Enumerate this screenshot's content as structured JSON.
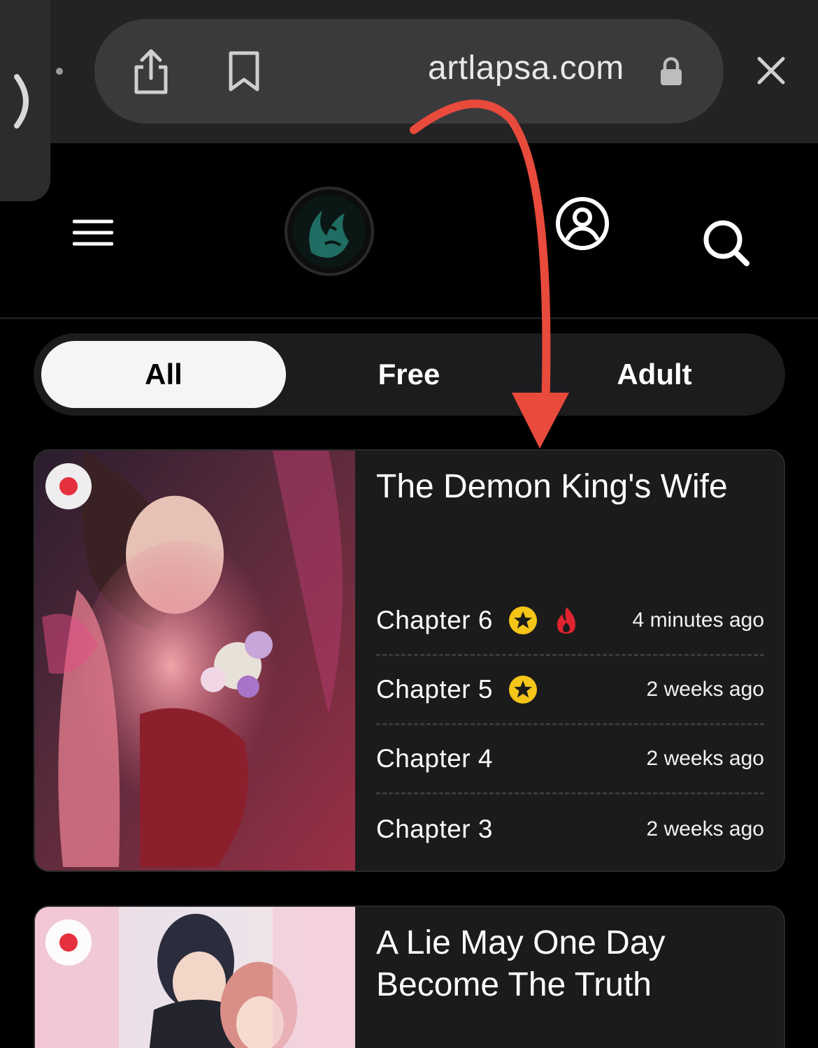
{
  "browser": {
    "url": "artlapsa.com"
  },
  "filters": {
    "all": "All",
    "free": "Free",
    "adult": "Adult"
  },
  "series": [
    {
      "title": "The Demon King's Wife",
      "chapters": [
        {
          "label": "Chapter 6",
          "time": "4 minutes ago"
        },
        {
          "label": "Chapter 5",
          "time": "2 weeks ago"
        },
        {
          "label": "Chapter 4",
          "time": "2 weeks ago"
        },
        {
          "label": "Chapter 3",
          "time": "2 weeks ago"
        }
      ]
    },
    {
      "title": "A Lie May One Day Become The Truth"
    }
  ],
  "colors": {
    "accent_red": "#e5303d",
    "star_yellow": "#f5c518",
    "arrow_red": "#e84a3c",
    "logo_teal": "#1f6d63"
  }
}
